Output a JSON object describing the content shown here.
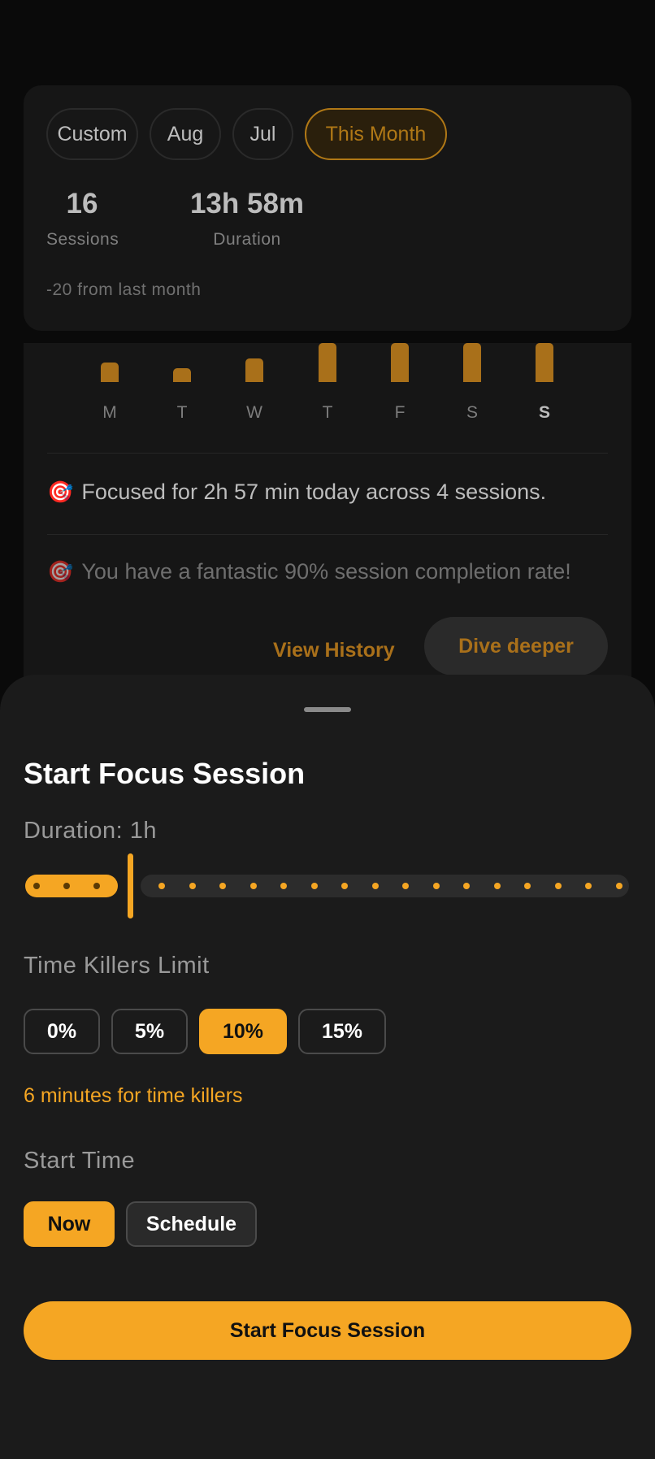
{
  "stats": {
    "periods": [
      "Custom",
      "Aug",
      "Jul",
      "This Month"
    ],
    "active_period": "This Month",
    "sessions_value": "16",
    "sessions_label": "Sessions",
    "duration_value": "13h 58m",
    "duration_label": "Duration",
    "comparison": "-20 from last month"
  },
  "weekly_chart": {
    "days": [
      "M",
      "T",
      "W",
      "T",
      "F",
      "S",
      "S"
    ],
    "today_index": 6,
    "bar_levels": [
      0.5,
      0.35,
      0.6,
      1.0,
      1.0,
      1.0,
      1.0
    ]
  },
  "insights": {
    "icon": "target-icon",
    "today": "Focused for 2h 57 min today across 4 sessions.",
    "completion": "You have a fantastic 90% session completion rate!"
  },
  "actions": {
    "view_history": "View History",
    "dive_deeper": "Dive deeper"
  },
  "sheet": {
    "title": "Start Focus Session",
    "duration_label": "Duration: 1h",
    "duration_level": 0.19,
    "time_killers_label": "Time Killers Limit",
    "time_killer_options": [
      "0%",
      "5%",
      "10%",
      "15%"
    ],
    "time_killer_selected": "10%",
    "time_killers_note": "6 minutes for time killers",
    "start_time_label": "Start Time",
    "start_time_options": [
      "Now",
      "Schedule"
    ],
    "start_time_selected": "Now",
    "start_button": "Start Focus Session"
  },
  "colors": {
    "accent": "#f5a623",
    "accent_dim": "#a9701a",
    "background": "#0a0a0a",
    "sheet": "#1b1b1b"
  }
}
